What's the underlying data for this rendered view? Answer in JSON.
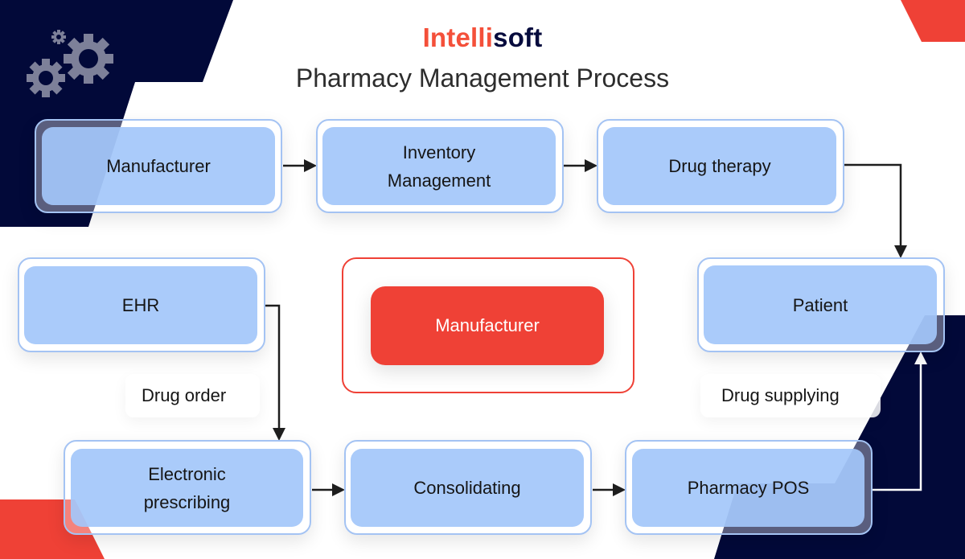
{
  "brand": {
    "logo_part1": "Intelli",
    "logo_part2": "soft",
    "accent_color": "#f4503a",
    "navy_color": "#060b3d"
  },
  "title": "Pharmacy Management Process",
  "nodes": {
    "manufacturer": "Manufacturer",
    "inventory_line1": "Inventory",
    "inventory_line2": "Management",
    "drug_therapy": "Drug therapy",
    "ehr": "EHR",
    "center": "Manufacturer",
    "patient": "Patient",
    "eprescribing_line1": "Electronic",
    "eprescribing_line2": "prescribing",
    "consolidating": "Consolidating",
    "pharmacy_pos": "Pharmacy POS"
  },
  "edge_labels": {
    "drug_order": "Drug order",
    "drug_supplying": "Drug supplying"
  },
  "icons": {
    "decor": "gears-icon"
  },
  "flow": [
    {
      "from": "Manufacturer",
      "to": "Inventory Management"
    },
    {
      "from": "Inventory Management",
      "to": "Drug therapy"
    },
    {
      "from": "Drug therapy",
      "to": "Patient"
    },
    {
      "from": "EHR",
      "to": "Electronic prescribing",
      "label": "Drug order"
    },
    {
      "from": "Electronic prescribing",
      "to": "Consolidating"
    },
    {
      "from": "Consolidating",
      "to": "Pharmacy POS"
    },
    {
      "from": "Pharmacy POS",
      "to": "Patient",
      "label": "Drug supplying"
    }
  ]
}
